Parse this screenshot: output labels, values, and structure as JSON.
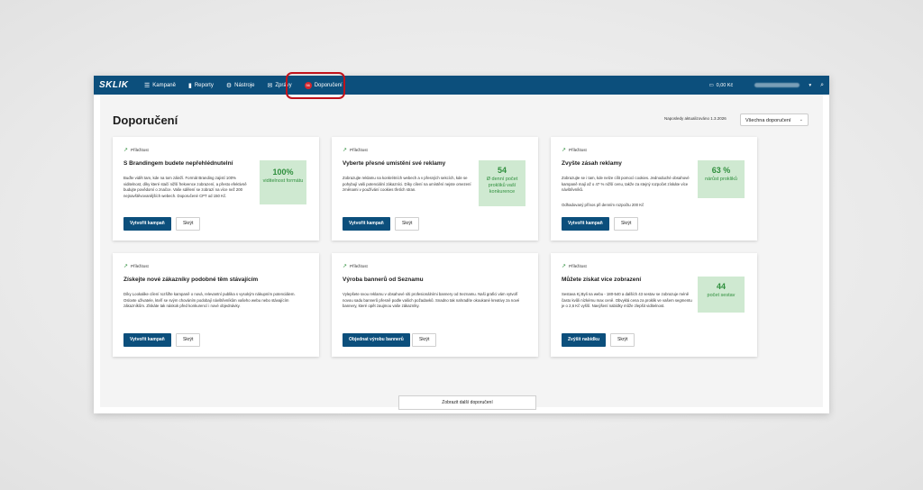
{
  "topbar": {
    "logo": "SKLIK",
    "nav": [
      {
        "label": "Kampaně",
        "icon": "menu-icon"
      },
      {
        "label": "Reporty",
        "icon": "bar-chart-icon"
      },
      {
        "label": "Nástroje",
        "icon": "gear-icon"
      },
      {
        "label": "Zprávy",
        "icon": "mail-icon"
      },
      {
        "label": "Doporučení",
        "icon": "notification-badge",
        "badge": "56"
      }
    ],
    "credit": "0,00 Kč"
  },
  "page": {
    "title": "Doporučení",
    "updated": "Naposledy aktualizováno 1.3.2026",
    "filter": "Všechna doporučení",
    "more_button": "Zobrazit další doporučení"
  },
  "cards": [
    {
      "tag": "Příležitost",
      "title": "S Brandingem budete nepřehlédnutelní",
      "desc": "Buďte vidět tam, kde na tom záleží. Formát Branding zajistí 100% viditelnost, díky které stačí nižší frekvence zobrazení, a přesto efektivně budujte povědomí o značce. Vaše sdělení se zobrazí na více než 200 nejnavštěvovanějších webech. Doporučené CPT od 150 Kč.",
      "metric_value": "100%",
      "metric_label": "viditelnost formátu",
      "primary": "Vytvořit kampaň",
      "secondary": "Skrýt"
    },
    {
      "tag": "Příležitost",
      "title": "Vyberte přesné umístění své reklamy",
      "desc": "Zobrazujte reklamu na konkrétních webech a v přesných sekcích, kde se pohybují vaši potenciální zákazníci. Díky cílení na umístění nejste omezení změnami v používání cookies třetích stran.",
      "metric_value": "54",
      "metric_label": "Ø denní počet prokliků vaší konkurence",
      "primary": "Vytvořit kampaň",
      "secondary": "Skrýt"
    },
    {
      "tag": "Příležitost",
      "title": "Zvyšte zásah reklamy",
      "desc": "Zobrazujte se i tam, kde nelze cílit pomocí cookies. Jednoduché obsahové kampaně mají až o 47 % nižší cenu, takže za stejný rozpočet získáte více návštěvníků.",
      "desc2": "Odhadovaný přínos při denním rozpočtu 200 Kč",
      "metric_value": "63 %",
      "metric_label": "nárůst prokliků",
      "primary": "Vytvořit kampaň",
      "secondary": "Skrýt"
    },
    {
      "tag": "Příležitost",
      "title": "Získejte nové zákazníky podobné těm stávajícím",
      "desc": "Díky Lookalike cílení rozšiřte kampaně o nová, relevantní publika s vysokým nákupním potenciálem. Oslovte uživatele, kteří se svým chováním podobají návštěvníkům vašeho webu nebo stávajícím zákazníkům. Získáte tak náskok před konkurencí i nové objednávky.",
      "primary": "Vytvořit kampaň",
      "secondary": "Skrýt"
    },
    {
      "tag": "Příležitost",
      "title": "Výroba bannerů od Seznamu",
      "desc": "Vylepšete svou reklamu v obsahové síti profesionálními bannery od Seznamu. Naši grafici vám vytvoří novou sadu bannerů přesně podle vašich požadavků. Snadno tak nahradíte okoukané kreativy za nové bannery, které opět zaujmou vaše zákazníky.",
      "primary": "Objednat výrobu bannerů",
      "secondary": "Skrýt"
    },
    {
      "tag": "Příležitost",
      "title": "Můžete získat více zobrazení",
      "desc": "Sestava Kj Byli na webu - 180-540 a dalších 43 sestav se zobrazuje méně často kvůli nízkému max ceně. Obvyklá cena za proklik ve vašem segmentu je o 2,6 Kč vyšší. Navýšení nabídky může zlepšit viditelnost.",
      "metric_value": "44",
      "metric_label": "počet sestav",
      "primary": "Zvýšit nabídku",
      "secondary": "Skrýt"
    }
  ]
}
